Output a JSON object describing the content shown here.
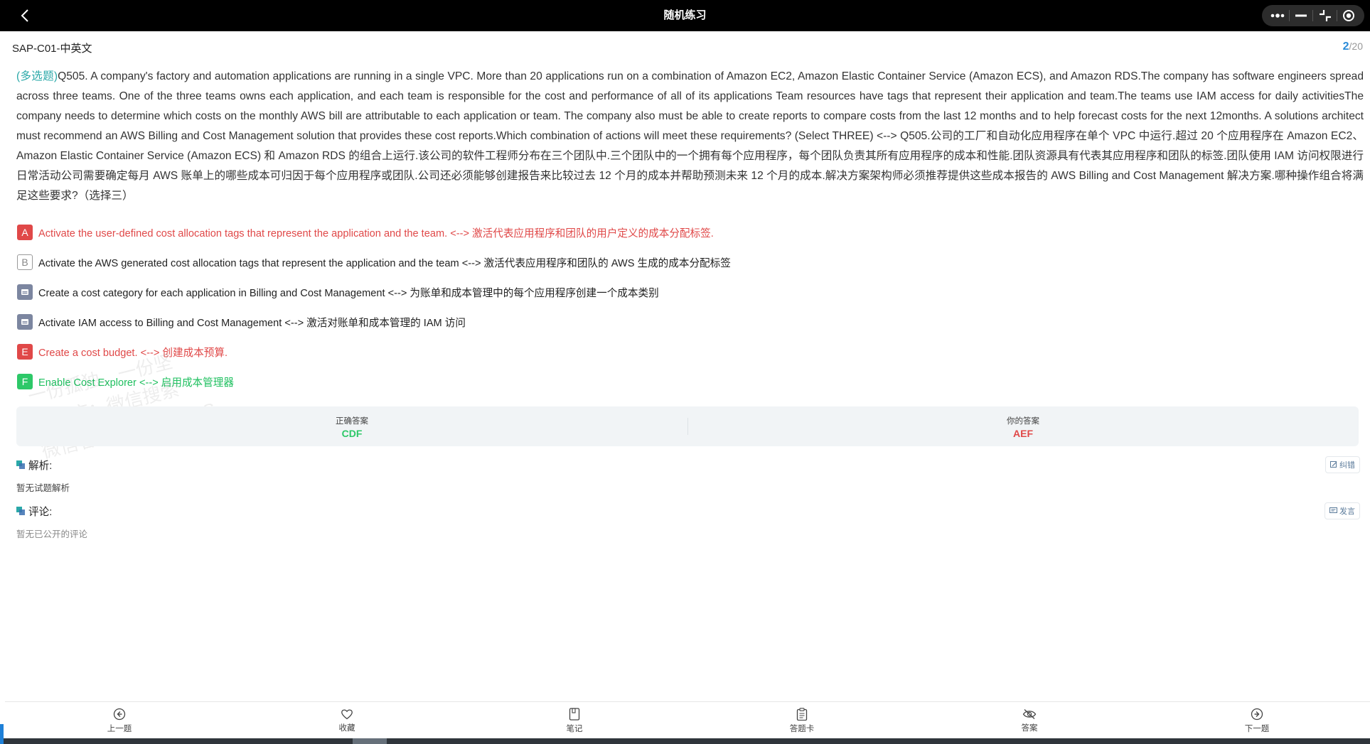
{
  "window": {
    "title": "随机练习",
    "back_icon": "chevron-left-icon",
    "capsule_icons": [
      "more-icon",
      "minimize-icon",
      "shrink-icon",
      "target-icon"
    ]
  },
  "header": {
    "exam_title": "SAP-C01-中英文",
    "current": "2",
    "total": "/20"
  },
  "question": {
    "type_label": "(多选题)",
    "text": "Q505. A company's factory and automation applications are running in a single VPC. More than 20 applications run on a combination of Amazon EC2, Amazon Elastic Container Service (Amazon ECS), and Amazon RDS.The company has software engineers spread across three teams. One of the three teams owns each application, and each team is responsible for the cost and performance of all of its applications Team resources have tags that represent their application and team.The teams use IAM access for daily activitiesThe company needs to determine which costs on the monthly AWS bill are attributable to each application or team. The company also must be able to create reports to compare costs from the last 12 months and to help forecast costs for the next 12months. A solutions architect must recommend an AWS Billing and Cost Management solution that provides these cost reports.Which combination of actions will meet these requirements? (Select THREE) <--> Q505.公司的工厂和自动化应用程序在单个 VPC 中运行.超过 20 个应用程序在 Amazon EC2、Amazon Elastic Container Service (Amazon ECS) 和 Amazon RDS 的组合上运行.该公司的软件工程师分布在三个团队中.三个团队中的一个拥有每个应用程序，每个团队负责其所有应用程序的成本和性能.团队资源具有代表其应用程序和团队的标签.团队使用 IAM 访问权限进行日常活动公司需要确定每月 AWS 账单上的哪些成本可归因于每个应用程序或团队.公司还必须能够创建报告来比较过去 12 个月的成本并帮助预测未来 12 个月的成本.解决方案架构师必须推荐提供这些成本报告的 AWS Billing and Cost Management 解决方案.哪种操作组合将满足这些要求?（选择三）"
  },
  "options": [
    {
      "marker": "A",
      "state": "wrong",
      "text": "Activate the user-defined cost allocation tags that represent the application and the team. <--> 激活代表应用程序和团队的用户定义的成本分配标签."
    },
    {
      "marker": "B",
      "state": "unselected",
      "text": "Activate the AWS generated cost allocation tags that represent the application and the team <--> 激活代表应用程序和团队的 AWS 生成的成本分配标签"
    },
    {
      "marker": "",
      "state": "missed",
      "icon": "correct-marker-icon",
      "text": "Create a cost category for each application in Billing and Cost Management <--> 为账单和成本管理中的每个应用程序创建一个成本类别"
    },
    {
      "marker": "",
      "state": "missed",
      "icon": "correct-marker-icon",
      "text": "Activate IAM access to Billing and Cost Management <--> 激活对账单和成本管理的 IAM 访问"
    },
    {
      "marker": "E",
      "state": "wrong",
      "text": "Create a cost budget. <--> 创建成本预算."
    },
    {
      "marker": "F",
      "state": "correct",
      "text": "Enable Cost Explorer <--> 启用成本管理器"
    }
  ],
  "watermark": {
    "lines": [
      "一份孤独，一份坚",
      "小程序：微信搜索",
      "微信客服：ANYPASS"
    ]
  },
  "answers": {
    "correct_label": "正确答案",
    "correct_value": "CDF",
    "yours_label": "你的答案",
    "yours_value": "AEF",
    "correct_color": "#2dc868",
    "yours_color": "#e04848"
  },
  "analysis": {
    "title": "解析:",
    "action_label": "纠错",
    "action_icon": "edit-icon",
    "body": "暂无试题解析"
  },
  "comments": {
    "title": "评论:",
    "action_label": "发言",
    "action_icon": "comment-icon",
    "body": "暂无已公开的评论"
  },
  "tabs": [
    {
      "label": "上一题",
      "icon": "arrow-left-circle-icon"
    },
    {
      "label": "收藏",
      "icon": "heart-icon"
    },
    {
      "label": "笔记",
      "icon": "notebook-icon"
    },
    {
      "label": "答题卡",
      "icon": "clipboard-icon"
    },
    {
      "label": "答案",
      "icon": "eye-off-icon"
    },
    {
      "label": "下一题",
      "icon": "arrow-right-circle-icon"
    }
  ],
  "colors": {
    "accent_teal": "#2aa8a8",
    "accent_blue": "#2a8bd8",
    "wrong_red": "#e04848",
    "correct_green": "#2dc868"
  }
}
